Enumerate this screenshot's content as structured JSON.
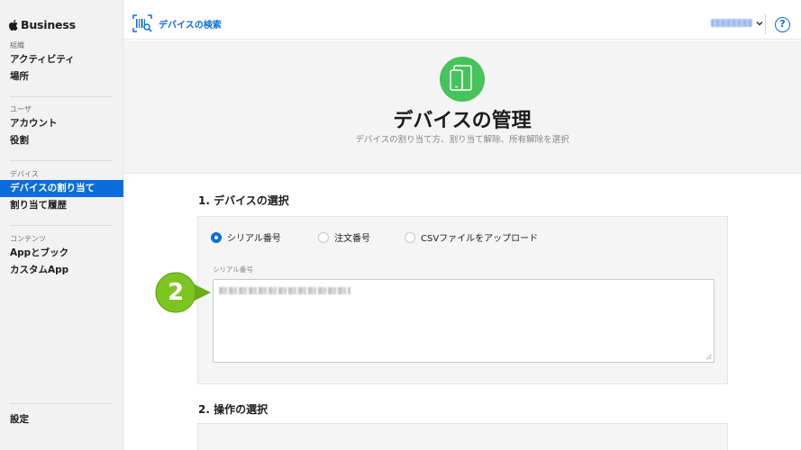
{
  "brand": {
    "name": "Business"
  },
  "sidebar": {
    "sections": [
      {
        "title": "組織",
        "items": [
          "アクティビティ",
          "場所"
        ]
      },
      {
        "title": "ユーザ",
        "items": [
          "アカウント",
          "役割"
        ]
      },
      {
        "title": "デバイス",
        "items": [
          "デバイスの割り当て",
          "割り当て履歴"
        ],
        "active": "デバイスの割り当て"
      },
      {
        "title": "コンテンツ",
        "items": [
          "Appとブック",
          "カスタムApp"
        ]
      }
    ],
    "footer": "設定"
  },
  "topbar": {
    "search_label": "デバイスの検索",
    "help": "?"
  },
  "hero": {
    "title": "デバイスの管理",
    "subtitle": "デバイスの割り当て方、割り当て解除、所有解除を選択"
  },
  "step1": {
    "title": "1. デバイスの選択",
    "options": [
      "シリアル番号",
      "注文番号",
      "CSVファイルをアップロード"
    ],
    "selected": "シリアル番号",
    "field_label": "シリアル番号"
  },
  "step2": {
    "title": "2. 操作の選択"
  },
  "marker": {
    "number": "2"
  },
  "colors": {
    "accent": "#0a6ddc",
    "hero_icon": "#46c35a",
    "marker": "#7cc520"
  }
}
